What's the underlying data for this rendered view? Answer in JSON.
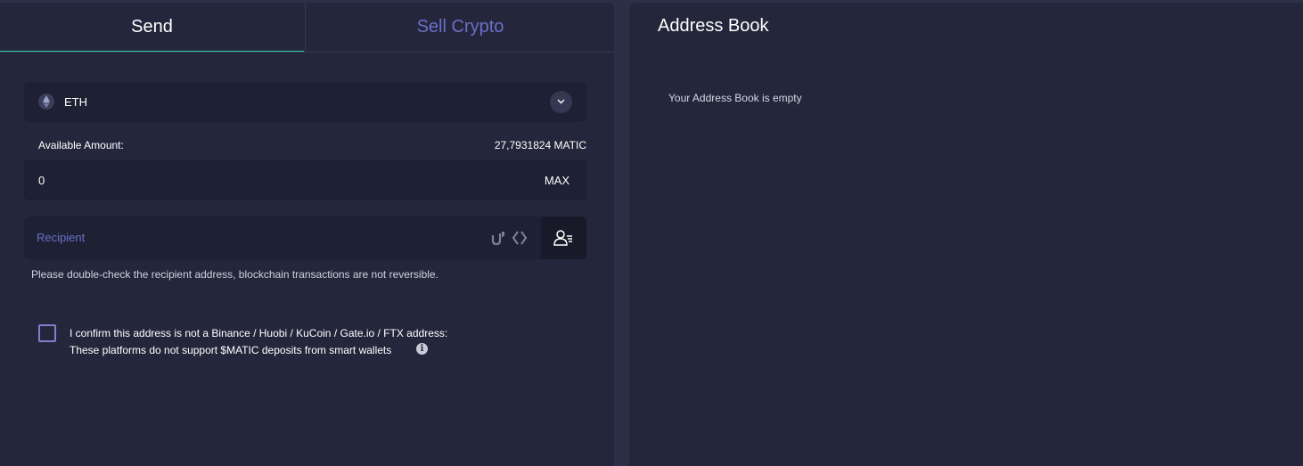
{
  "tabs": [
    {
      "label": "Send"
    },
    {
      "label": "Sell Crypto"
    }
  ],
  "token_select": {
    "value": "ETH",
    "icon": "ethereum-icon"
  },
  "available": {
    "label": "Available Amount:",
    "value": "27,7931824 MATIC"
  },
  "amount": {
    "value": "0",
    "max_label": "MAX"
  },
  "recipient": {
    "placeholder": "Recipient"
  },
  "warning_text": "Please double-check the recipient address, blockchain transactions are not reversible.",
  "confirm": {
    "line1": "I confirm this address is not a Binance / Huobi / KuCoin / Gate.io / FTX address:",
    "line2": "These platforms do not support $MATIC deposits from smart wallets",
    "checked": false
  },
  "address_book": {
    "title": "Address Book",
    "empty_text": "Your Address Book is empty"
  },
  "colors": {
    "background": "#2c3047",
    "panel": "#24273c",
    "field": "#1e2133",
    "accent_tab": "#2dc8a8",
    "accent_text": "#6a6fc9"
  }
}
